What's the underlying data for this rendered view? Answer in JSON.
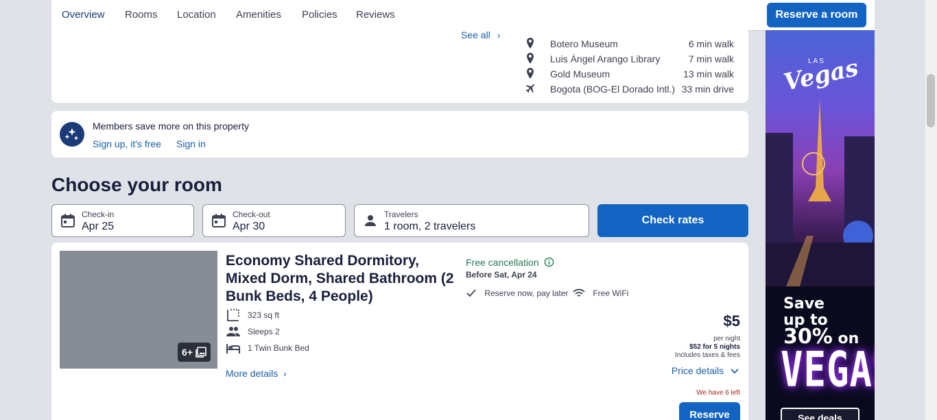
{
  "nav": {
    "tabs": [
      "Overview",
      "Rooms",
      "Location",
      "Amenities",
      "Policies",
      "Reviews"
    ],
    "active_tab": "Overview",
    "reserve_label": "Reserve a room"
  },
  "location": {
    "see_all": "See all",
    "pois": [
      {
        "name": "Botero Museum",
        "distance": "6 min walk",
        "icon": "map-pin-icon"
      },
      {
        "name": "Luis Ángel Arango Library",
        "distance": "7 min walk",
        "icon": "map-pin-icon"
      },
      {
        "name": "Gold Museum",
        "distance": "13 min walk",
        "icon": "map-pin-icon"
      },
      {
        "name": "Bogota (BOG-El Dorado Intl.)",
        "distance": "33 min drive",
        "icon": "airplane-icon"
      }
    ]
  },
  "members": {
    "text": "Members save more on this property",
    "signup": "Sign up, it's free",
    "signin": "Sign in"
  },
  "choose_heading": "Choose your room",
  "search": {
    "checkin_label": "Check-in",
    "checkin_value": "Apr 25",
    "checkout_label": "Check-out",
    "checkout_value": "Apr 30",
    "travelers_label": "Travelers",
    "travelers_value": "1 room, 2 travelers",
    "check_rates": "Check rates"
  },
  "room": {
    "image_count": "6+",
    "title": "Economy Shared Dormitory, Mixed Dorm, Shared Bathroom (2 Bunk Beds, 4 People)",
    "features": [
      {
        "text": "323 sq ft",
        "icon": "floor-area-icon"
      },
      {
        "text": "Sleeps 2",
        "icon": "people-icon"
      },
      {
        "text": "1 Twin Bunk Bed",
        "icon": "bed-icon"
      }
    ],
    "more_details": "More details",
    "free_cancellation": "Free cancellation",
    "before": "Before Sat, Apr 24",
    "perk_reserve": "Reserve now, pay later",
    "perk_wifi": "Free WiFi",
    "price": "$5",
    "per_night": "per night",
    "total": "$52 for 5 nights",
    "includes": "Includes taxes & fees",
    "price_details": "Price details",
    "left": "We have 6 left",
    "reserve": "Reserve"
  },
  "ad": {
    "las": "LAS",
    "vegas_script": "Vegas",
    "save_line1": "Save",
    "save_line2": "up to",
    "percent": "30%",
    "on": "on",
    "big": "VEGAS",
    "cta": "See deals"
  },
  "colors": {
    "brand_blue": "#1364c2",
    "link_blue": "#1a5fa8",
    "green": "#227950",
    "page_bg": "#dfe3e8"
  }
}
